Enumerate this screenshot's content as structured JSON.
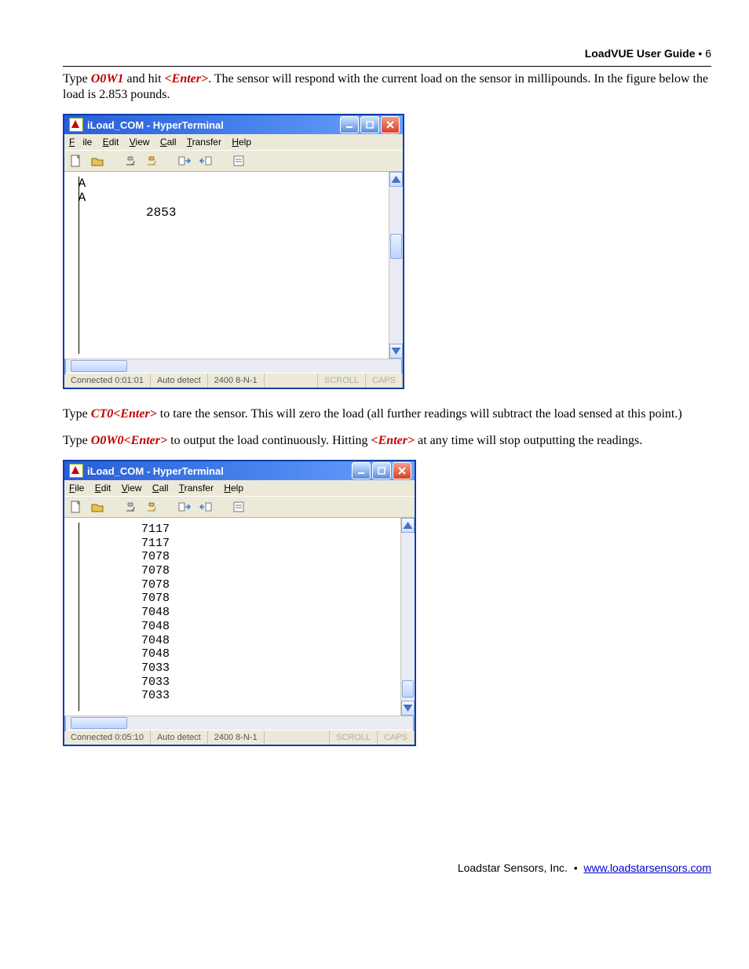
{
  "header": {
    "title": "LoadVUE User Guide",
    "sep": "•",
    "page": "6"
  },
  "para1": {
    "pre": "Type ",
    "cmd1": "O0W1",
    "mid1": " and hit ",
    "cmd2": "<Enter>",
    "post": ". The sensor will respond with the current load on the sensor in millipounds. In the figure below the load is 2.853 pounds."
  },
  "para2": {
    "pre": "Type ",
    "cmd": "CT0<Enter>",
    "post": " to tare the sensor. This will zero the load (all further readings will subtract the load sensed at this point.)"
  },
  "para3": {
    "pre": "Type ",
    "cmd1": "O0W0<Enter>",
    "mid": " to output the load continuously. Hitting ",
    "cmd2": "<Enter>",
    "post": " at any time will stop outputting the readings."
  },
  "menus": {
    "file": "File",
    "edit": "Edit",
    "view": "View",
    "call": "Call",
    "transfer": "Transfer",
    "help": "Help"
  },
  "win1": {
    "title": "iLoad_COM - HyperTerminal",
    "terminal_text": " A\n A\n          2853",
    "status": {
      "conn": "Connected 0:01:01",
      "detect": "Auto detect",
      "proto": "2400 8-N-1",
      "scroll": "SCROLL",
      "caps": "CAPS"
    }
  },
  "win2": {
    "title": "iLoad_COM - HyperTerminal",
    "terminal_text": "          7117\n          7117\n          7078\n          7078\n          7078\n          7078\n          7048\n          7048\n          7048\n          7048\n          7033\n          7033\n          7033",
    "status": {
      "conn": "Connected 0:05:10",
      "detect": "Auto detect",
      "proto": "2400 8-N-1",
      "scroll": "SCROLL",
      "caps": "CAPS"
    }
  },
  "footer": {
    "company": "Loadstar Sensors, Inc.",
    "sep": "•",
    "url": "www.loadstarsensors.com"
  }
}
